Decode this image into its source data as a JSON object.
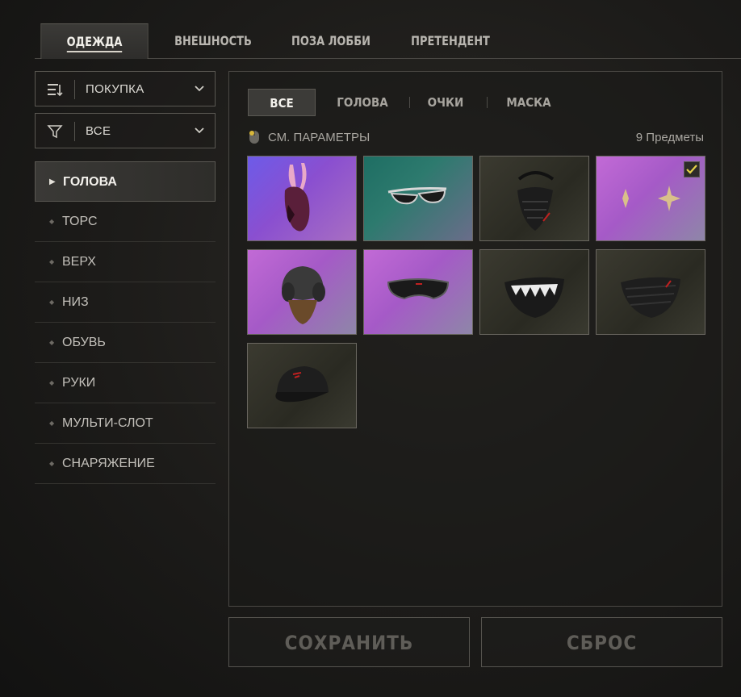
{
  "top_tabs": [
    {
      "label": "ОДЕЖДА",
      "active": true
    },
    {
      "label": "ВНЕШНОСТЬ",
      "active": false
    },
    {
      "label": "ПОЗА ЛОББИ",
      "active": false
    },
    {
      "label": "ПРЕТЕНДЕНТ",
      "active": false
    }
  ],
  "sort_dropdown": {
    "icon": "sort-icon",
    "value": "ПОКУПКА"
  },
  "filter_dropdown": {
    "icon": "filter-icon",
    "value": "ВСЕ"
  },
  "categories": [
    {
      "label": "ГОЛОВА",
      "active": true
    },
    {
      "label": "ТОРС"
    },
    {
      "label": "ВЕРХ"
    },
    {
      "label": "НИЗ"
    },
    {
      "label": "ОБУВЬ"
    },
    {
      "label": "РУКИ"
    },
    {
      "label": "МУЛЬТИ-СЛОТ"
    },
    {
      "label": "СНАРЯЖЕНИЕ"
    }
  ],
  "sub_tabs": [
    {
      "label": "ВСЕ",
      "active": true
    },
    {
      "label": "ГОЛОВА"
    },
    {
      "label": "ОЧКИ"
    },
    {
      "label": "МАСКА"
    }
  ],
  "params_label": "СМ. ПАРАМЕТРЫ",
  "item_count": "9 Предметы",
  "items": [
    {
      "icon": "bunny-hood-icon",
      "rarity": "purple"
    },
    {
      "icon": "sunglasses-icon",
      "rarity": "teal"
    },
    {
      "icon": "face-mask-icon",
      "rarity": "dark"
    },
    {
      "icon": "star-earrings-icon",
      "rarity": "pink",
      "equipped": true
    },
    {
      "icon": "aviator-helmet-icon",
      "rarity": "pink"
    },
    {
      "icon": "dark-goggles-icon",
      "rarity": "pink"
    },
    {
      "icon": "shark-mask-icon",
      "rarity": "dark"
    },
    {
      "icon": "black-mask-icon",
      "rarity": "dark"
    },
    {
      "icon": "baseball-cap-icon",
      "rarity": "dark"
    }
  ],
  "buttons": {
    "save": "СОХРАНИТЬ",
    "reset": "СБРОС"
  },
  "colors": {
    "text_active": "#f3f1ec",
    "check": "#e6d24a",
    "button_text": "#5f5d58"
  }
}
